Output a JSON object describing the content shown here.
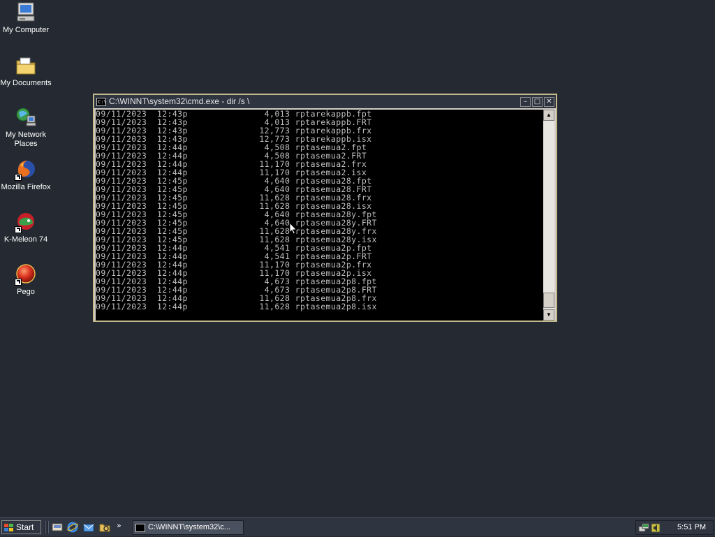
{
  "desktop": {
    "icons": [
      {
        "label": "My Computer",
        "icon": "computer-icon"
      },
      {
        "label": "My Documents",
        "icon": "folder-icon"
      },
      {
        "label": "My Network Places",
        "icon": "network-icon"
      },
      {
        "label": "Mozilla Firefox",
        "icon": "firefox-icon"
      },
      {
        "label": "K-Meleon 74",
        "icon": "kmeleon-icon"
      },
      {
        "label": "Pego",
        "icon": "pego-icon"
      }
    ]
  },
  "window": {
    "title": "C:\\WINNT\\system32\\cmd.exe - dir /s \\",
    "lines": [
      "09/11/2023  12:43p               4,013 rptarekappb.fpt",
      "09/11/2023  12:43p               4,013 rptarekappb.FRT",
      "09/11/2023  12:43p              12,773 rptarekappb.frx",
      "09/11/2023  12:43p              12,773 rptarekappb.isx",
      "09/11/2023  12:44p               4,508 rptasemua2.fpt",
      "09/11/2023  12:44p               4,508 rptasemua2.FRT",
      "09/11/2023  12:44p              11,170 rptasemua2.frx",
      "09/11/2023  12:44p              11,170 rptasemua2.isx",
      "09/11/2023  12:45p               4,640 rptasemua28.fpt",
      "09/11/2023  12:45p               4,640 rptasemua28.FRT",
      "09/11/2023  12:45p              11,628 rptasemua28.frx",
      "09/11/2023  12:45p              11,628 rptasemua28.isx",
      "09/11/2023  12:45p               4,640 rptasemua28y.fpt",
      "09/11/2023  12:45p               4,640 rptasemua28y.FRT",
      "09/11/2023  12:45p              11,628 rptasemua28y.frx",
      "09/11/2023  12:45p              11,628 rptasemua28y.isx",
      "09/11/2023  12:44p               4,541 rptasemua2p.fpt",
      "09/11/2023  12:44p               4,541 rptasemua2p.FRT",
      "09/11/2023  12:44p              11,170 rptasemua2p.frx",
      "09/11/2023  12:44p              11,170 rptasemua2p.isx",
      "09/11/2023  12:44p               4,673 rptasemua2p8.fpt",
      "09/11/2023  12:44p               4,673 rptasemua2p8.FRT",
      "09/11/2023  12:44p              11,628 rptasemua2p8.frx",
      "09/11/2023  12:44p              11,628 rptasemua2p8.isx"
    ],
    "buttons": {
      "minimize": "minimize-icon",
      "maximize": "maximize-icon",
      "close": "close-icon"
    }
  },
  "taskbar": {
    "start_label": "Start",
    "quick_launch": [
      "show-desktop-icon",
      "internet-explorer-icon",
      "outlook-express-icon",
      "explorer-icon"
    ],
    "overflow": "»",
    "task_label": "C:\\WINNT\\system32\\c...",
    "clock": "5:51 PM"
  },
  "colors": {
    "desktop": "#252a32",
    "taskbar": "#2e3440",
    "console_bg": "#000000",
    "console_text": "#c0c0c0"
  }
}
